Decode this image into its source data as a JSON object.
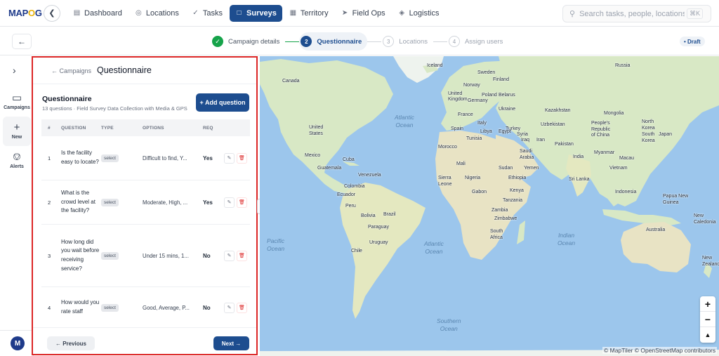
{
  "app": {
    "logo_text_a": "MAP",
    "logo_text_b": "G",
    "logo_text_c": "",
    "back_icon": "chevron-left-icon"
  },
  "nav": {
    "items": [
      {
        "label": "Dashboard",
        "icon": "bar-chart-icon"
      },
      {
        "label": "Locations",
        "icon": "pin-icon"
      },
      {
        "label": "Tasks",
        "icon": "check-icon"
      },
      {
        "label": "Surveys",
        "icon": "clipboard-icon",
        "active": true
      },
      {
        "label": "Territory",
        "icon": "map-icon"
      },
      {
        "label": "Field Ops",
        "icon": "send-icon"
      },
      {
        "label": "Logistics",
        "icon": "box-icon"
      }
    ]
  },
  "search": {
    "placeholder": "Search tasks, people, locations...",
    "shortcut": "⌘K"
  },
  "stepper": {
    "steps": [
      {
        "num": "✓",
        "label": "Campaign details",
        "state": "done"
      },
      {
        "num": "2",
        "label": "Questionnaire",
        "state": "current"
      },
      {
        "num": "3",
        "label": "Locations",
        "state": "upcoming"
      },
      {
        "num": "4",
        "label": "Assign users",
        "state": "upcoming"
      }
    ],
    "status": "• Draft"
  },
  "rail": {
    "items": [
      {
        "label": "Campaigns",
        "icon": "clipboard-icon"
      },
      {
        "label": "New",
        "icon": "plus-icon"
      },
      {
        "label": "Alerts",
        "icon": "bell-icon"
      }
    ],
    "avatar": "M"
  },
  "panel": {
    "crumb": "← Campaigns",
    "title": "Questionnaire",
    "heading": "Questionnaire",
    "subtitle": "13 questions · Field Survey Data Collection with Media & GPS",
    "add_button": "+ Add question",
    "columns": [
      "#",
      "QUESTION",
      "TYPE",
      "OPTIONS",
      "REQ"
    ],
    "rows": [
      {
        "num": "1",
        "question": "Is the facility easy to locate?",
        "type": "select",
        "options": "Difficult to find, Y...",
        "req": "Yes"
      },
      {
        "num": "2",
        "question": "What is the crowd level at the facility?",
        "type": "select",
        "options": "Moderate, High, ...",
        "req": "Yes"
      },
      {
        "num": "3",
        "question": "How long did you wait before receiving service?",
        "type": "select",
        "options": "Under 15 mins, 1...",
        "req": "No"
      },
      {
        "num": "4",
        "question": "How would you rate staff",
        "type": "select",
        "options": "Good, Average, P...",
        "req": "No"
      }
    ],
    "prev_button": "← Previous",
    "next_button": "Next →"
  },
  "map": {
    "labels": {
      "iceland": "Iceland",
      "russia": "Russia",
      "canada": "Canada",
      "sweden": "Sweden",
      "norway": "Norway",
      "finland": "Finland",
      "uk": "United\nKingdom",
      "poland": "Poland",
      "germany": "Germany",
      "belarus": "Belarus",
      "ukraine": "Ukraine",
      "france": "France",
      "spain": "Spain",
      "italy": "Italy",
      "turkey": "Turkey",
      "kazakhstan": "Kazakhstan",
      "mongolia": "Mongolia",
      "uzbekistan": "Uzbekistan",
      "china": "People's\nRepublic\nof China",
      "usa": "United\nStates",
      "mexico": "Mexico",
      "cuba": "Cuba",
      "guatemala": "Guatemala",
      "venezuela": "Venezuela",
      "colombia": "Colombia",
      "ecuador": "Ecuador",
      "peru": "Peru",
      "bolivia": "Bolivia",
      "brazil": "Brazil",
      "paraguay": "Paraguay",
      "uruguay": "Uruguay",
      "chile": "Chile",
      "morocco": "Morocco",
      "tunisia": "Tunisia",
      "libya": "Libya",
      "egypt": "Egypt",
      "syria": "Syria",
      "iraq": "Iraq",
      "iran": "Iran",
      "pakistan": "Pakistan",
      "saudi": "Saudi\nArabia",
      "yemen": "Yemen",
      "sudan": "Sudan",
      "mali": "Mali",
      "nigeria": "Nigeria",
      "sierra": "Sierra\nLeone",
      "ethiopia": "Ethiopia",
      "gabon": "Gabon",
      "kenya": "Kenya",
      "tanzania": "Tanzania",
      "zambia": "Zambia",
      "zimbabwe": "Zimbabwe",
      "south_africa": "South\nAfrica",
      "india": "India",
      "srilanka": "Sri Lanka",
      "myanmar": "Myanmar",
      "vietnam": "Vietnam",
      "macau": "Macau",
      "japan": "Japan",
      "north_korea": "North\nKorea",
      "south_korea": "South\nKorea",
      "indonesia": "Indonesia",
      "png": "Papua New\nGuinea",
      "australia": "Australia",
      "new_caledonia": "New\nCaledonia",
      "new_zealand": "New\nZealand"
    },
    "oceans": {
      "atlantic_n": "Atlantic\nOcean",
      "pacific": "Pacific\nOcean",
      "atlantic_s": "Atlantic\nOcean",
      "indian": "Indian\nOcean",
      "southern": "Southern\nOcean"
    },
    "zoom_in": "+",
    "zoom_out": "−",
    "compass": "▲",
    "attribution": "© MapTiler © OpenStreetMap contributors"
  },
  "colors": {
    "accent": "#1d4d8f",
    "done": "#16a34a",
    "danger": "#dc2626",
    "land": "#d8e8c5",
    "water": "#9cc6ec"
  }
}
